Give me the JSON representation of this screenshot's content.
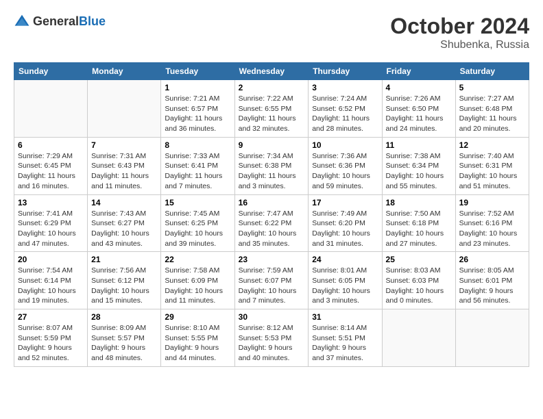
{
  "logo": {
    "general": "General",
    "blue": "Blue"
  },
  "title": "October 2024",
  "location": "Shubenka, Russia",
  "headers": [
    "Sunday",
    "Monday",
    "Tuesday",
    "Wednesday",
    "Thursday",
    "Friday",
    "Saturday"
  ],
  "weeks": [
    [
      {
        "day": "",
        "info": ""
      },
      {
        "day": "",
        "info": ""
      },
      {
        "day": "1",
        "info": "Sunrise: 7:21 AM\nSunset: 6:57 PM\nDaylight: 11 hours and 36 minutes."
      },
      {
        "day": "2",
        "info": "Sunrise: 7:22 AM\nSunset: 6:55 PM\nDaylight: 11 hours and 32 minutes."
      },
      {
        "day": "3",
        "info": "Sunrise: 7:24 AM\nSunset: 6:52 PM\nDaylight: 11 hours and 28 minutes."
      },
      {
        "day": "4",
        "info": "Sunrise: 7:26 AM\nSunset: 6:50 PM\nDaylight: 11 hours and 24 minutes."
      },
      {
        "day": "5",
        "info": "Sunrise: 7:27 AM\nSunset: 6:48 PM\nDaylight: 11 hours and 20 minutes."
      }
    ],
    [
      {
        "day": "6",
        "info": "Sunrise: 7:29 AM\nSunset: 6:45 PM\nDaylight: 11 hours and 16 minutes."
      },
      {
        "day": "7",
        "info": "Sunrise: 7:31 AM\nSunset: 6:43 PM\nDaylight: 11 hours and 11 minutes."
      },
      {
        "day": "8",
        "info": "Sunrise: 7:33 AM\nSunset: 6:41 PM\nDaylight: 11 hours and 7 minutes."
      },
      {
        "day": "9",
        "info": "Sunrise: 7:34 AM\nSunset: 6:38 PM\nDaylight: 11 hours and 3 minutes."
      },
      {
        "day": "10",
        "info": "Sunrise: 7:36 AM\nSunset: 6:36 PM\nDaylight: 10 hours and 59 minutes."
      },
      {
        "day": "11",
        "info": "Sunrise: 7:38 AM\nSunset: 6:34 PM\nDaylight: 10 hours and 55 minutes."
      },
      {
        "day": "12",
        "info": "Sunrise: 7:40 AM\nSunset: 6:31 PM\nDaylight: 10 hours and 51 minutes."
      }
    ],
    [
      {
        "day": "13",
        "info": "Sunrise: 7:41 AM\nSunset: 6:29 PM\nDaylight: 10 hours and 47 minutes."
      },
      {
        "day": "14",
        "info": "Sunrise: 7:43 AM\nSunset: 6:27 PM\nDaylight: 10 hours and 43 minutes."
      },
      {
        "day": "15",
        "info": "Sunrise: 7:45 AM\nSunset: 6:25 PM\nDaylight: 10 hours and 39 minutes."
      },
      {
        "day": "16",
        "info": "Sunrise: 7:47 AM\nSunset: 6:22 PM\nDaylight: 10 hours and 35 minutes."
      },
      {
        "day": "17",
        "info": "Sunrise: 7:49 AM\nSunset: 6:20 PM\nDaylight: 10 hours and 31 minutes."
      },
      {
        "day": "18",
        "info": "Sunrise: 7:50 AM\nSunset: 6:18 PM\nDaylight: 10 hours and 27 minutes."
      },
      {
        "day": "19",
        "info": "Sunrise: 7:52 AM\nSunset: 6:16 PM\nDaylight: 10 hours and 23 minutes."
      }
    ],
    [
      {
        "day": "20",
        "info": "Sunrise: 7:54 AM\nSunset: 6:14 PM\nDaylight: 10 hours and 19 minutes."
      },
      {
        "day": "21",
        "info": "Sunrise: 7:56 AM\nSunset: 6:12 PM\nDaylight: 10 hours and 15 minutes."
      },
      {
        "day": "22",
        "info": "Sunrise: 7:58 AM\nSunset: 6:09 PM\nDaylight: 10 hours and 11 minutes."
      },
      {
        "day": "23",
        "info": "Sunrise: 7:59 AM\nSunset: 6:07 PM\nDaylight: 10 hours and 7 minutes."
      },
      {
        "day": "24",
        "info": "Sunrise: 8:01 AM\nSunset: 6:05 PM\nDaylight: 10 hours and 3 minutes."
      },
      {
        "day": "25",
        "info": "Sunrise: 8:03 AM\nSunset: 6:03 PM\nDaylight: 10 hours and 0 minutes."
      },
      {
        "day": "26",
        "info": "Sunrise: 8:05 AM\nSunset: 6:01 PM\nDaylight: 9 hours and 56 minutes."
      }
    ],
    [
      {
        "day": "27",
        "info": "Sunrise: 8:07 AM\nSunset: 5:59 PM\nDaylight: 9 hours and 52 minutes."
      },
      {
        "day": "28",
        "info": "Sunrise: 8:09 AM\nSunset: 5:57 PM\nDaylight: 9 hours and 48 minutes."
      },
      {
        "day": "29",
        "info": "Sunrise: 8:10 AM\nSunset: 5:55 PM\nDaylight: 9 hours and 44 minutes."
      },
      {
        "day": "30",
        "info": "Sunrise: 8:12 AM\nSunset: 5:53 PM\nDaylight: 9 hours and 40 minutes."
      },
      {
        "day": "31",
        "info": "Sunrise: 8:14 AM\nSunset: 5:51 PM\nDaylight: 9 hours and 37 minutes."
      },
      {
        "day": "",
        "info": ""
      },
      {
        "day": "",
        "info": ""
      }
    ]
  ]
}
